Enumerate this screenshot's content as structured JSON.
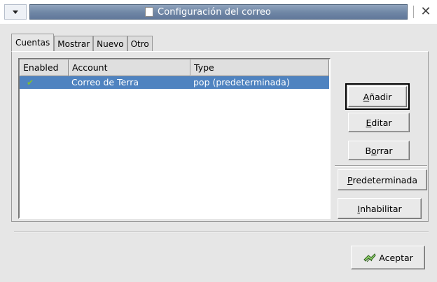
{
  "window": {
    "title": "Configuración del correo",
    "close_glyph": "✕"
  },
  "tabs": [
    {
      "label": "Cuentas",
      "active": true
    },
    {
      "label": "Mostrar",
      "active": false
    },
    {
      "label": "Nuevo",
      "active": false
    },
    {
      "label": "Otro",
      "active": false
    }
  ],
  "accounts_table": {
    "columns": [
      "Enabled",
      "Account",
      "Type"
    ],
    "rows": [
      {
        "enabled": true,
        "enabled_glyph": "✔",
        "account": "Correo de Terra",
        "type": "pop (predeterminada)",
        "selected": true
      }
    ]
  },
  "buttons": {
    "add": {
      "prefix": "",
      "mnemonic": "A",
      "suffix": "ñadir"
    },
    "edit": {
      "prefix": "",
      "mnemonic": "E",
      "suffix": "ditar"
    },
    "delete": {
      "prefix": "B",
      "mnemonic": "o",
      "suffix": "rrar"
    },
    "default": {
      "prefix": "",
      "mnemonic": "P",
      "suffix": "redeterminada"
    },
    "disable": {
      "prefix": "",
      "mnemonic": "I",
      "suffix": "nhabilitar"
    },
    "accept": {
      "label": "Aceptar"
    }
  },
  "icons": {
    "window_menu": "chevron-down-icon",
    "title": "document-icon",
    "close": "close-icon",
    "accept": "handshake-icon",
    "enabled": "checkmark-icon"
  },
  "colors": {
    "selection": "#4f83c0",
    "titlebar": "#6f86a5",
    "check": "#7fbf2f"
  }
}
